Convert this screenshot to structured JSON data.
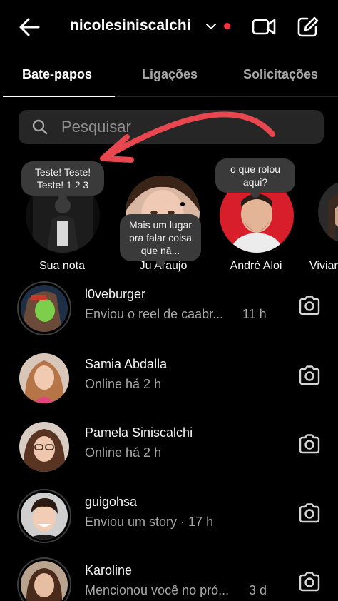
{
  "header": {
    "username": "nicolesiniscalchi",
    "back_icon": "back-arrow-icon",
    "video_icon": "video-call-icon",
    "compose_icon": "compose-icon",
    "status_dot_color": "#ff3040"
  },
  "tabs": [
    {
      "label": "Bate-papos",
      "active": true
    },
    {
      "label": "Ligações",
      "active": false
    },
    {
      "label": "Solicitações",
      "active": false
    }
  ],
  "search": {
    "placeholder": "Pesquisar",
    "icon": "search-icon"
  },
  "notes": [
    {
      "name": "Sua nota",
      "bubble": "Teste! Teste! Teste! 1 2 3"
    },
    {
      "name": "Ju Araujo",
      "bubble": "Mais um lugar pra falar coisa que nã..."
    },
    {
      "name": "André Aloi",
      "bubble": "o que rolou aqui?"
    },
    {
      "name": "Vivian",
      "bubble": ""
    }
  ],
  "chats": [
    {
      "name": "l0veburger",
      "subtitle": "Enviou o reel de caabr...",
      "time": "11 h"
    },
    {
      "name": "Samia Abdalla",
      "subtitle": "Online há 2 h",
      "time": ""
    },
    {
      "name": "Pamela Siniscalchi",
      "subtitle": "Online há 2 h",
      "time": ""
    },
    {
      "name": "guigohsa",
      "subtitle": "Enviou um story · 17 h",
      "time": ""
    },
    {
      "name": "Karoline",
      "subtitle": "Mencionou você no pró...",
      "time": "3 d"
    }
  ],
  "colors": {
    "background": "#000000",
    "surface": "#262626",
    "annotation_arrow": "#e8474f"
  }
}
